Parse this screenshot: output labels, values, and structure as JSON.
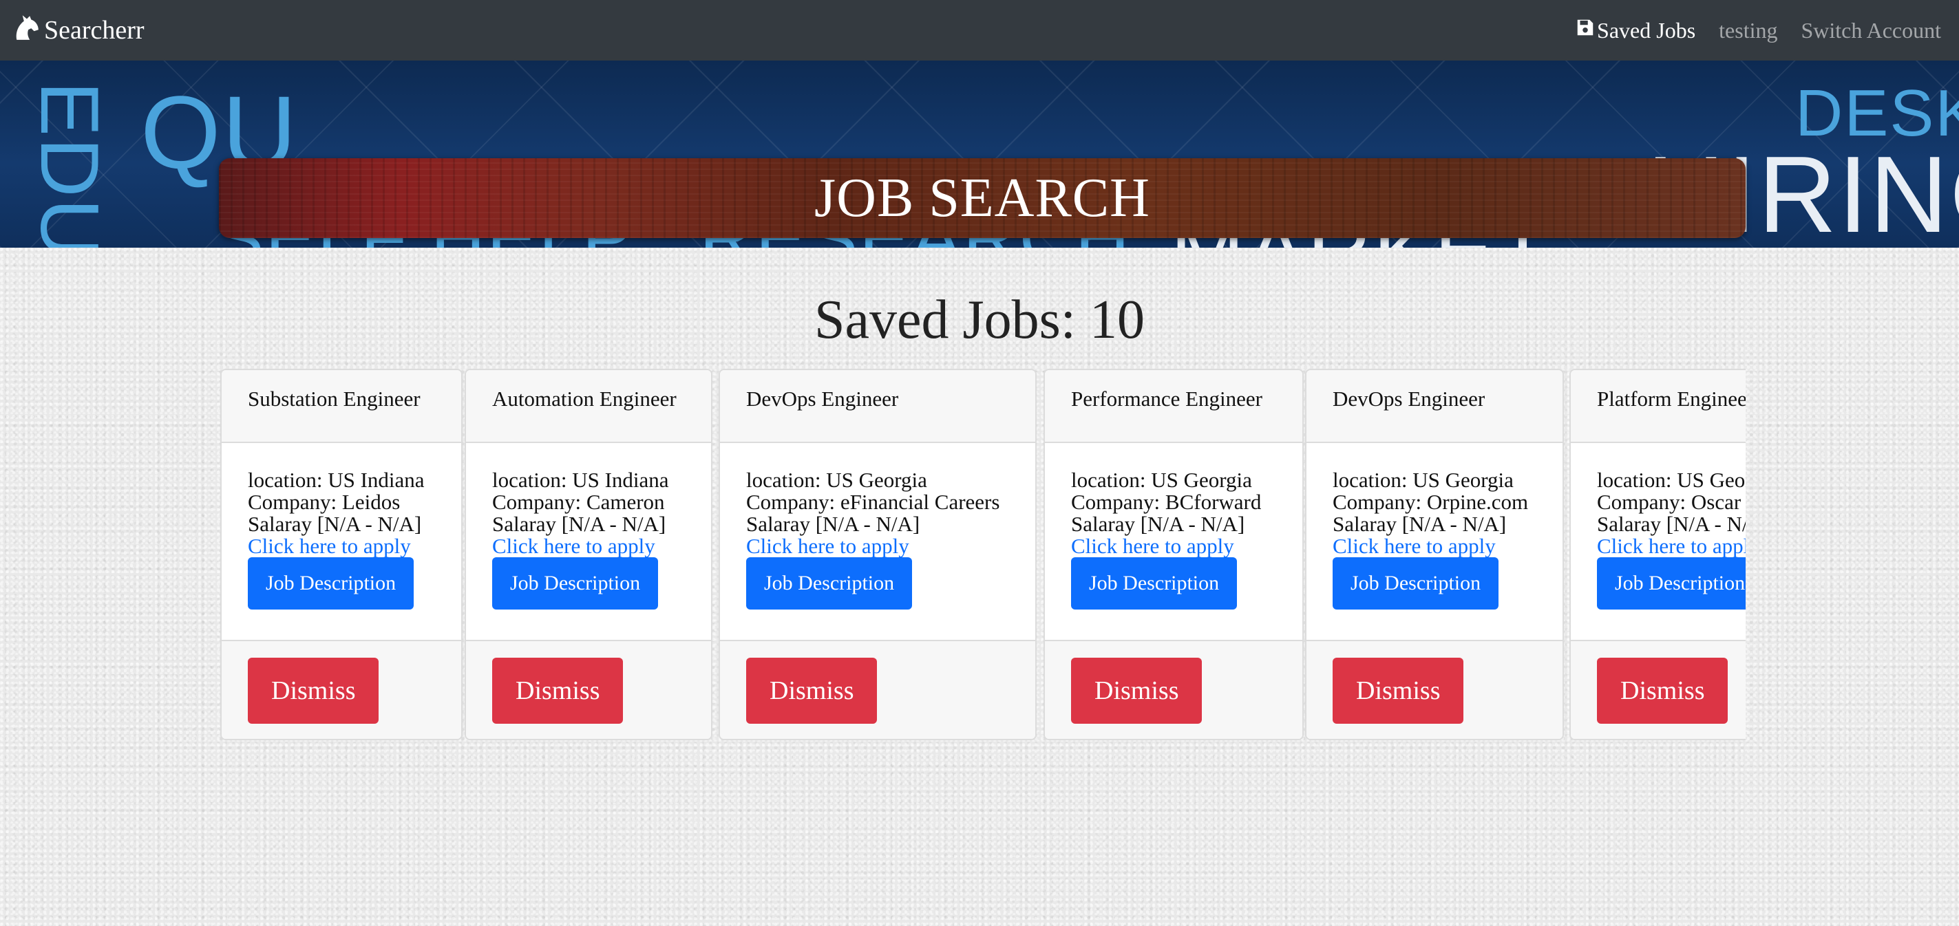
{
  "navbar": {
    "brand": "Searcherr",
    "saved_jobs_label": "Saved Jobs",
    "user_label": "testing",
    "switch_account_label": "Switch Account"
  },
  "hero": {
    "title": "JOB SEARCH",
    "background_words": [
      "EDU",
      "QU",
      "SELF HELP",
      "RESEARCH",
      "MARKET",
      "DESK",
      "HIRING"
    ]
  },
  "saved_count_title": "Saved Jobs: 10",
  "jobs": [
    {
      "title": "Substation Engineer",
      "location": "location: US Indiana",
      "company": "Company: Leidos",
      "salary": "Salaray [N/A - N/A]",
      "apply": "Click here to apply",
      "desc_btn": "Job Description",
      "dismiss_btn": "Dismiss"
    },
    {
      "title": "Automation Engineer",
      "location": "location: US Indiana",
      "company": "Company: Cameron",
      "salary": "Salaray [N/A - N/A]",
      "apply": "Click here to apply",
      "desc_btn": "Job Description",
      "dismiss_btn": "Dismiss"
    },
    {
      "title": "DevOps Engineer",
      "location": "location: US Georgia",
      "company": "Company: eFinancial Careers",
      "salary": "Salaray [N/A - N/A]",
      "apply": "Click here to apply",
      "desc_btn": "Job Description",
      "dismiss_btn": "Dismiss"
    },
    {
      "title": "Performance Engineer",
      "location": "location: US Georgia",
      "company": "Company: BCforward",
      "salary": "Salaray [N/A - N/A]",
      "apply": "Click here to apply",
      "desc_btn": "Job Description",
      "dismiss_btn": "Dismiss"
    },
    {
      "title": "DevOps Engineer",
      "location": "location: US Georgia",
      "company": "Company: Orpine.com",
      "salary": "Salaray [N/A - N/A]",
      "apply": "Click here to apply",
      "desc_btn": "Job Description",
      "dismiss_btn": "Dismiss"
    },
    {
      "title": "Platform Engineer",
      "location": "location: US Georgia",
      "company": "Company: Oscar",
      "salary": "Salaray [N/A - N/A]",
      "apply": "Click here to apply",
      "desc_btn": "Job Description",
      "dismiss_btn": "Dismiss"
    }
  ],
  "colors": {
    "navbar": "#343a40",
    "primary": "#0d6efd",
    "danger": "#dc3545"
  }
}
